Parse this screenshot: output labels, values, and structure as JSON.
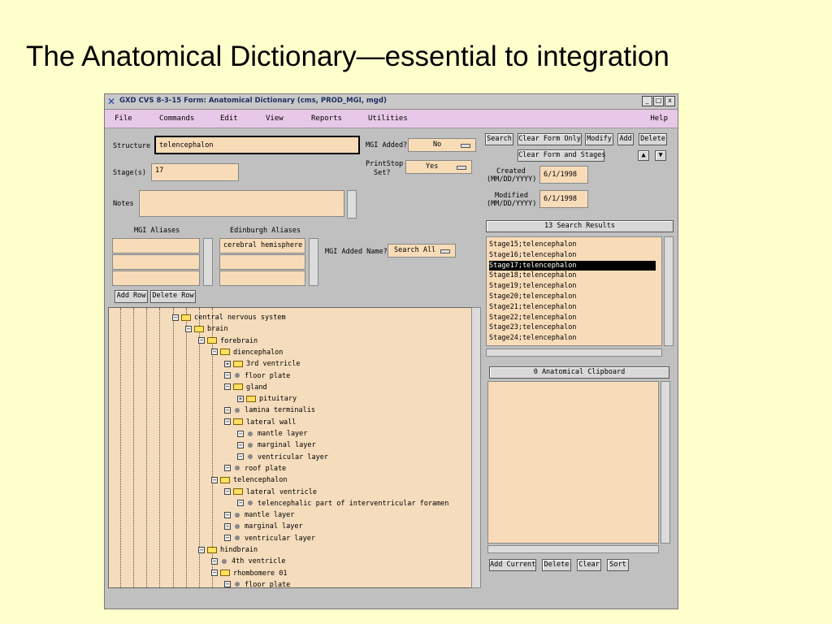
{
  "slide": {
    "title": "The Anatomical Dictionary—essential to integration"
  },
  "window": {
    "title": "GXD CVS 8-3-15 Form: Anatomical Dictionary (cms, PROD_MGI, mgd)",
    "controls": {
      "minimize": "_",
      "maximize": "□",
      "close": "x"
    }
  },
  "menu": {
    "file": "File",
    "commands": "Commands",
    "edit": "Edit",
    "view": "View",
    "reports": "Reports",
    "utilities": "Utilities",
    "help": "Help"
  },
  "form": {
    "structure_label": "Structure",
    "structure_value": "telencephalon",
    "mgi_added_label": "MGI Added?",
    "mgi_added_value": "No",
    "stages_label": "Stage(s)",
    "stages_value": "17",
    "printstop_label_1": "PrintStop",
    "printstop_label_2": "Set?",
    "printstop_value": "Yes",
    "notes_label": "Notes",
    "notes_value": "",
    "mgi_aliases_label": "MGI Aliases",
    "edinburgh_aliases_label": "Edinburgh Aliases",
    "edinburgh_aliases": [
      "cerebral hemisphere",
      "",
      ""
    ],
    "mgi_added_name_label": "MGI Added Name?",
    "mgi_added_name_value": "Search All",
    "add_row": "Add Row",
    "delete_row": "Delete Row"
  },
  "actions": {
    "search": "Search",
    "clear_form_only": "Clear Form Only",
    "modify": "Modify",
    "add": "Add",
    "delete": "Delete",
    "clear_form_and_stages": "Clear Form and Stages",
    "created_label_1": "Created",
    "created_label_2": "(MM/DD/YYYY)",
    "created_value": "6/1/1998",
    "modified_label_1": "Modified",
    "modified_label_2": "(MM/DD/YYYY)",
    "modified_value": "6/1/1998"
  },
  "results": {
    "header": "13 Search Results",
    "items": [
      "Stage15;telencephalon",
      "Stage16;telencephalon",
      "Stage17;telencephalon",
      "Stage18;telencephalon",
      "Stage19;telencephalon",
      "Stage20;telencephalon",
      "Stage21;telencephalon",
      "Stage22;telencephalon",
      "Stage23;telencephalon",
      "Stage24;telencephalon"
    ],
    "selected": "Stage17;telencephalon"
  },
  "clipboard": {
    "header": "0 Anatomical Clipboard",
    "add_current": "Add Current",
    "delete": "Delete",
    "clear": "Clear",
    "sort": "Sort"
  },
  "tree": [
    {
      "label": "central nervous system",
      "expander": "−",
      "icon": "folder"
    },
    {
      "label": "brain",
      "expander": "−",
      "icon": "folder"
    },
    {
      "label": "forebrain",
      "expander": "−",
      "icon": "folder"
    },
    {
      "label": "diencephalon",
      "expander": "−",
      "icon": "folder"
    },
    {
      "label": "3rd ventricle",
      "expander": "+",
      "icon": "folder"
    },
    {
      "label": "floor plate",
      "expander": "−",
      "icon": "leaf"
    },
    {
      "label": "gland",
      "expander": "−",
      "icon": "folder"
    },
    {
      "label": "pituitary",
      "expander": "+",
      "icon": "folder"
    },
    {
      "label": "lamina terminalis",
      "expander": "−",
      "icon": "leaf"
    },
    {
      "label": "lateral wall",
      "expander": "−",
      "icon": "folder"
    },
    {
      "label": "mantle layer",
      "expander": "−",
      "icon": "leaf"
    },
    {
      "label": "marginal layer",
      "expander": "−",
      "icon": "leaf"
    },
    {
      "label": "ventricular layer",
      "expander": "−",
      "icon": "leaf"
    },
    {
      "label": "roof plate",
      "expander": "−",
      "icon": "leaf"
    },
    {
      "label": "telencephalon",
      "expander": "−",
      "icon": "folder"
    },
    {
      "label": "lateral ventricle",
      "expander": "−",
      "icon": "folder"
    },
    {
      "label": "telencephalic part of interventricular foramen",
      "expander": "−",
      "icon": "leaf"
    },
    {
      "label": "mantle layer",
      "expander": "−",
      "icon": "leaf"
    },
    {
      "label": "marginal layer",
      "expander": "−",
      "icon": "leaf"
    },
    {
      "label": "ventricular layer",
      "expander": "−",
      "icon": "leaf"
    },
    {
      "label": "hindbrain",
      "expander": "−",
      "icon": "folder"
    },
    {
      "label": "4th ventricle",
      "expander": "−",
      "icon": "leaf"
    },
    {
      "label": "rhombomere 01",
      "expander": "−",
      "icon": "folder"
    },
    {
      "label": "floor plate",
      "expander": "−",
      "icon": "leaf"
    }
  ]
}
